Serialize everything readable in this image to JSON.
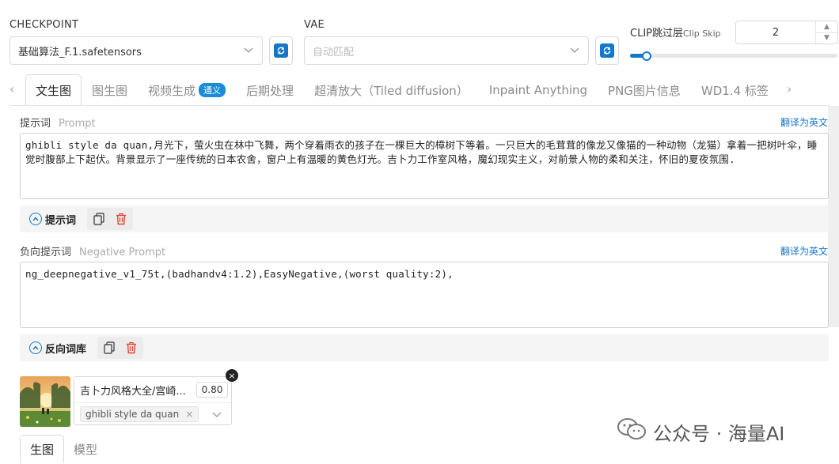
{
  "checkpoint": {
    "label": "CHECKPOINT",
    "value": "基础算法_F.1.safetensors"
  },
  "vae": {
    "label": "VAE",
    "placeholder": "自动匹配"
  },
  "clip": {
    "label": "CLIP跳过层",
    "sublabel": "Clip Skip",
    "value": "2",
    "slider_fraction": 0.08
  },
  "tabs": [
    {
      "label": "文生图"
    },
    {
      "label": "图生图"
    },
    {
      "label": "视频生成",
      "badge": "通义"
    },
    {
      "label": "后期处理"
    },
    {
      "label": "超清放大（Tiled diffusion）"
    },
    {
      "label": "Inpaint Anything"
    },
    {
      "label": "PNG图片信息"
    },
    {
      "label": "WD1.4 标签"
    }
  ],
  "prompt": {
    "label": "提示词",
    "sublabel": "Prompt",
    "translate": "翻译为英文",
    "text": "ghibli style da quan,月光下，萤火虫在林中飞舞，两个穿着雨衣的孩子在一棵巨大的樟树下等着。一只巨大的毛茸茸的像龙又像猫的一种动物（龙猫）拿着一把树叶伞，睡觉时腹部上下起伏。背景显示了一座传统的日本农舍，窗户上有温暖的黄色灯光。吉卜力工作室风格，魔幻现实主义，对前景人物的柔和关注，怀旧的夏夜氛围.",
    "toggle_label": "提示词"
  },
  "negative": {
    "label": "负向提示词",
    "sublabel": "Negative Prompt",
    "translate": "翻译为英文",
    "text": "ng_deepnegative_v1_75t,(badhandv4:1.2),EasyNegative,(worst quality:2),",
    "toggle_label": "反向词库"
  },
  "lora": {
    "name": "吉卜力风格大全/宫崎...",
    "weight": "0.80",
    "tag": "ghibli style da quan"
  },
  "bottom_tabs": [
    {
      "label": "生图"
    },
    {
      "label": "模型"
    }
  ],
  "watermark": "公众号 · 海量AI",
  "colors": {
    "accent": "#1677c9",
    "danger": "#e0443e"
  }
}
